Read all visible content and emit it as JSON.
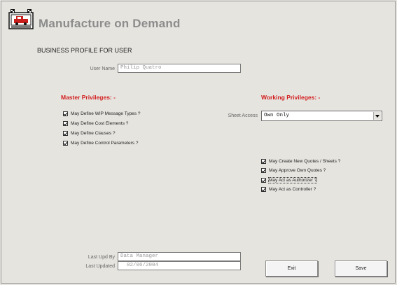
{
  "app": {
    "title": "Manufacture on Demand"
  },
  "profile": {
    "section_title": "BUSINESS PROFILE FOR USER",
    "user_name_label": "User Name",
    "user_name_value": "Philip Quatro"
  },
  "master": {
    "heading": "Master Privileges: -",
    "items": [
      {
        "label": "May Define WIP Message Types ?",
        "checked": true
      },
      {
        "label": "May Define Cost Elements ?",
        "checked": true
      },
      {
        "label": "May Define Clauses ?",
        "checked": true
      },
      {
        "label": "May Define Control Parameters ?",
        "checked": true
      }
    ]
  },
  "working": {
    "heading": "Working Privileges: -",
    "sheet_access_label": "Sheet Access",
    "sheet_access_value": "Own Only",
    "items": [
      {
        "label": "May Create New Quotes / Sheets ?",
        "checked": true
      },
      {
        "label": "May Approve Own Quotes ?",
        "checked": true
      },
      {
        "label": "May Act as Authorizer ?",
        "checked": true,
        "focused": true
      },
      {
        "label": "May Act as Controller ?",
        "checked": true
      }
    ]
  },
  "footer": {
    "last_upd_by_label": "Last Upd By",
    "last_upd_by_value": "Data Manager",
    "last_updated_label": "Last Updated",
    "last_updated_value": "02/06/2004"
  },
  "buttons": {
    "exit": "Exit",
    "save": "Save"
  },
  "icons": {
    "logo": "machine-monitor-icon"
  }
}
